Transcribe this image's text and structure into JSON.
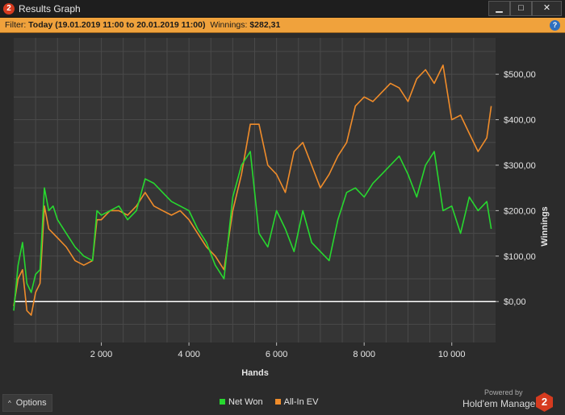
{
  "window": {
    "title": "Results Graph",
    "app_icon": "2",
    "min_glyph": "▁",
    "max_glyph": "□",
    "close_glyph": "✕"
  },
  "filter": {
    "prefix": "Filter: ",
    "range": "Today (19.01.2019 11:00 to 20.01.2019 11:00)",
    "winnings_label": "Winnings: ",
    "winnings_value": "$282,31",
    "help_glyph": "?"
  },
  "footer": {
    "options_label": "Options",
    "options_chevron": "^",
    "powered_by": "Powered by",
    "brand": "Hold'em Manager",
    "brand_logo": "2"
  },
  "colors": {
    "net_won": "#27d82f",
    "all_in_ev": "#f08c2a",
    "zero_line": "#ffffff",
    "plot_bg": "#353535",
    "grid": "#4a4a4a"
  },
  "chart_data": {
    "type": "line",
    "xlabel": "Hands",
    "ylabel": "Winnings",
    "xlim": [
      0,
      11000
    ],
    "ylim": [
      -90,
      580
    ],
    "x_ticks": [
      2000,
      4000,
      6000,
      8000,
      10000
    ],
    "x_tick_labels": [
      "2 000",
      "4 000",
      "6 000",
      "8 000",
      "10 000"
    ],
    "y_ticks": [
      0,
      100,
      200,
      300,
      400,
      500
    ],
    "y_tick_labels": [
      "$0,00",
      "$100,00",
      "$200,00",
      "$300,00",
      "$400,00",
      "$500,00"
    ],
    "grid": true,
    "legend_position": "bottom",
    "series": [
      {
        "name": "Net Won",
        "color": "#27d82f",
        "x": [
          0,
          100,
          200,
          300,
          400,
          500,
          600,
          700,
          800,
          900,
          1000,
          1200,
          1400,
          1600,
          1800,
          1900,
          2000,
          2200,
          2400,
          2600,
          2800,
          3000,
          3200,
          3400,
          3600,
          3800,
          4000,
          4200,
          4400,
          4600,
          4800,
          5000,
          5200,
          5400,
          5600,
          5800,
          6000,
          6200,
          6400,
          6600,
          6800,
          7000,
          7200,
          7400,
          7600,
          7800,
          8000,
          8200,
          8400,
          8600,
          8800,
          9000,
          9200,
          9400,
          9600,
          9800,
          10000,
          10200,
          10400,
          10600,
          10800,
          10900
        ],
        "y": [
          -20,
          80,
          130,
          40,
          20,
          60,
          70,
          250,
          200,
          210,
          180,
          150,
          120,
          100,
          90,
          200,
          190,
          200,
          210,
          180,
          200,
          270,
          260,
          240,
          220,
          210,
          200,
          160,
          130,
          80,
          50,
          230,
          300,
          330,
          150,
          120,
          200,
          160,
          110,
          200,
          130,
          110,
          90,
          180,
          240,
          250,
          230,
          260,
          280,
          300,
          320,
          280,
          230,
          300,
          330,
          200,
          210,
          150,
          230,
          200,
          220,
          160
        ]
      },
      {
        "name": "All-In EV",
        "color": "#f08c2a",
        "x": [
          0,
          100,
          200,
          300,
          400,
          500,
          600,
          700,
          800,
          900,
          1000,
          1200,
          1400,
          1600,
          1800,
          1900,
          2000,
          2200,
          2400,
          2600,
          2800,
          3000,
          3200,
          3400,
          3600,
          3800,
          4000,
          4200,
          4400,
          4600,
          4800,
          5000,
          5200,
          5400,
          5600,
          5800,
          6000,
          6200,
          6400,
          6600,
          6800,
          7000,
          7200,
          7400,
          7600,
          7800,
          8000,
          8200,
          8400,
          8600,
          8800,
          9000,
          9200,
          9400,
          9600,
          9800,
          10000,
          10200,
          10400,
          10600,
          10800,
          10900
        ],
        "y": [
          -10,
          50,
          70,
          -20,
          -30,
          20,
          40,
          210,
          160,
          150,
          140,
          120,
          90,
          80,
          90,
          180,
          180,
          200,
          200,
          190,
          210,
          240,
          210,
          200,
          190,
          200,
          180,
          150,
          120,
          100,
          70,
          200,
          280,
          390,
          390,
          300,
          280,
          240,
          330,
          350,
          300,
          250,
          280,
          320,
          350,
          430,
          450,
          440,
          460,
          480,
          470,
          440,
          490,
          510,
          480,
          520,
          400,
          410,
          370,
          330,
          360,
          430
        ]
      }
    ]
  }
}
